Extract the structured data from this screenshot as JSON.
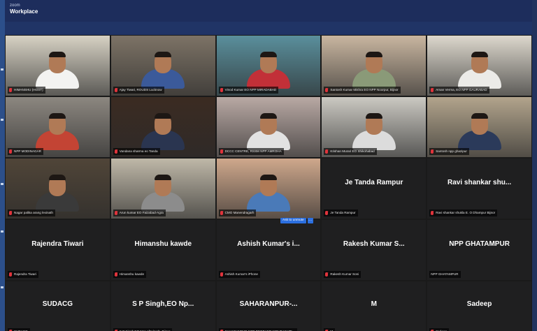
{
  "app": {
    "brand_small": "zoom",
    "brand_name": "Workplace"
  },
  "colors": {
    "titlebar": "#1d2d5c",
    "active_speaker": "#3fce7c",
    "muted_icon": "#e0343c",
    "button": "#2b6fe0"
  },
  "ask_to_unmute": {
    "label": "Ask to unmute",
    "more": "···"
  },
  "participants": [
    {
      "name": "HIMANSHU (HOST)",
      "video": true,
      "active": true,
      "bg": "#d7d2c4",
      "shirt": "#f3f3f1"
    },
    {
      "name": "Ajay Tiwari, ROUDS Lucknow",
      "video": true,
      "bg": "#7d7366",
      "shirt": "#3b5a9a"
    },
    {
      "name": "Vinod Kumar EO NPP MIRADABAD",
      "video": true,
      "bg": "#5a8f9c",
      "shirt": "#c23038"
    },
    {
      "name": "Santosh Kumar Mishra EO NPP Noorpur, Bijnor",
      "video": true,
      "bg": "#c9b6a0",
      "shirt": "#8a9a78"
    },
    {
      "name": "Aman Verma, EO NPP GAURABAD",
      "video": true,
      "bg": "#ddd8cd",
      "shirt": "#ecebe8"
    },
    {
      "name": "NPP MODINAGAR",
      "video": true,
      "bg": "#8c8780",
      "shirt": "#c34434"
    },
    {
      "name": "Vandana sharma eo Tanda",
      "video": true,
      "bg": "#3b2b22",
      "shirt": "#2a3550"
    },
    {
      "name": "DCCC CENTRE, RSSM NPP AMROHA",
      "video": true,
      "bg": "#b9a9a4",
      "shirt": "#e2e2e2"
    },
    {
      "name": "Krishan Murari EO Shikohabad",
      "video": true,
      "bg": "#cbc9c2",
      "shirt": "#dcdcdc"
    },
    {
      "name": "Santosh npp ghazipur",
      "video": true,
      "bg": "#b2a48c",
      "shirt": "#2b3a5a"
    },
    {
      "name": "Nagar palika arang lexinath",
      "video": true,
      "bg": "#504538",
      "shirt": "#3a3a3a"
    },
    {
      "name": "Arun kumar EO Faizabad-Agra",
      "video": true,
      "bg": "#bfb8a8",
      "shirt": "#8c8c8c"
    },
    {
      "name": "CMO Manendragarh",
      "video": true,
      "bg": "#cfa88c",
      "shirt": "#4a7ab8"
    },
    {
      "name": "Je Tanda Rampur",
      "display": "Je Tanda Rampur",
      "video": false
    },
    {
      "name": "Ravi shankar shukla E. O Dhampur Bijnor",
      "display": "Ravi shankar shu...",
      "video": false
    },
    {
      "name": "Rajendra Tiwari",
      "display": "Rajendra Tiwari",
      "video": false
    },
    {
      "name": "Himanshu kawde",
      "display": "Himanshu kawde",
      "video": false
    },
    {
      "name": "Ashish Kumar's iPhone",
      "display": "Ashish Kumar's i...",
      "video": false
    },
    {
      "name": "Rakesh Kumar Soni",
      "display": "Rakesh Kumar S...",
      "video": false
    },
    {
      "name": "NPP GHATAMPUR",
      "display": "NPP GHATAMPUR",
      "video": false,
      "unmuted": true
    },
    {
      "name": "SUDACG",
      "display": "SUDACG",
      "video": false
    },
    {
      "name": "S P Singh,EO Npp afzalgarh, Bijnor",
      "display": "S P Singh,EO Np...",
      "video": false
    },
    {
      "name": "SAHARANPUR-NPP DEOBAND-MOHD MAZE...",
      "display": "SAHARANPUR-...",
      "video": false
    },
    {
      "name": "M",
      "display": "M",
      "video": false
    },
    {
      "name": "Sadeep",
      "display": "Sadeep",
      "video": false
    }
  ]
}
